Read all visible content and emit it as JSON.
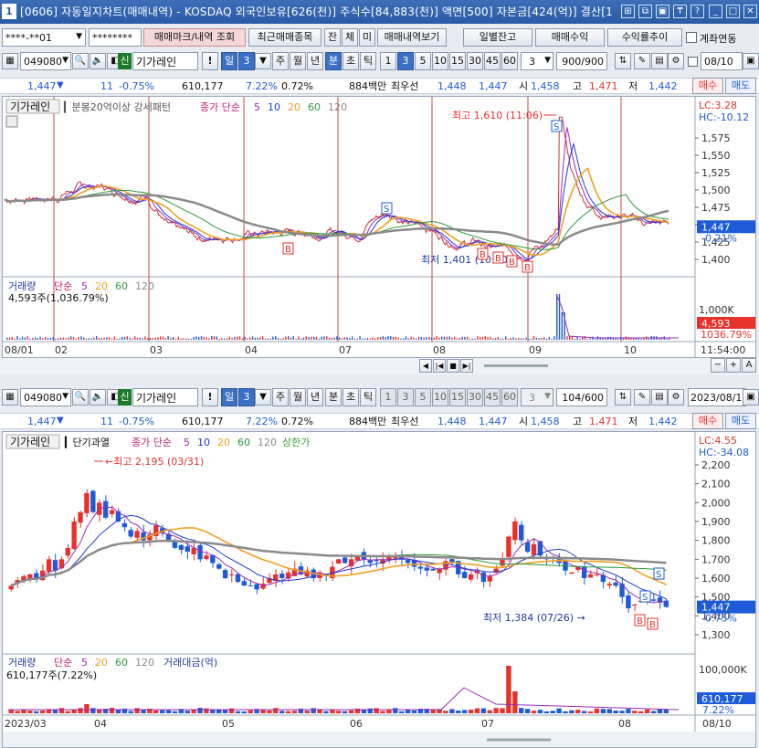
{
  "title": "[0606] 자동일지차트(매매내역) - KOSDAQ 외국인보유[626(천)] 주식수[84,883(천)] 액면[500] 자본금[424(억)] 결산[1",
  "title_buttons": [
    "⊞",
    "⧉",
    "▣",
    "₸",
    "?",
    "_",
    "□",
    "✕"
  ],
  "account": {
    "id": "****-**01",
    "password": "********",
    "btn_mark": "매매마크/내역 조회",
    "btn_recent": "최근매매종목",
    "tab_jan": "잔",
    "tab_che": "체",
    "tab_mi": "미",
    "btn_history": "매매내역보기",
    "btn_daily": "일별잔고",
    "btn_profit": "매매수익",
    "btn_return": "수익률추이",
    "chk_account": "계좌연동"
  },
  "top_toolbar": {
    "code": "049080",
    "badge": "신",
    "name": "기가레인",
    "excl": "!",
    "period_btn": "일",
    "period_num": "3",
    "periods": [
      "주",
      "월",
      "년",
      "분",
      "초",
      "틱"
    ],
    "minute_nums": [
      "1",
      "3",
      "5",
      "10",
      "15",
      "30",
      "45",
      "60"
    ],
    "count_select": "3",
    "range": "900/900",
    "date": "08/10"
  },
  "bottom_toolbar": {
    "code": "049080",
    "badge": "신",
    "name": "기가레인",
    "excl": "!",
    "period_btn": "일",
    "period_num": "3",
    "periods": [
      "주",
      "월",
      "년",
      "분",
      "초",
      "틱"
    ],
    "minute_nums": [
      "1",
      "3",
      "5",
      "10",
      "15",
      "30",
      "45",
      "60"
    ],
    "count_select": "3",
    "range": "104/600",
    "date": "2023/08/10"
  },
  "price_row": {
    "price": "1,447",
    "change": "11",
    "pct": "-0.75%",
    "volume": "610,177",
    "vol_pct": "7.22%",
    "turnover": "0.72%",
    "amount": "884백만",
    "best_label": "최우선",
    "bid1": "1,448",
    "ask1": "1,447",
    "open_label": "시",
    "open": "1,458",
    "high_label": "고",
    "high": "1,471",
    "low_label": "저",
    "low": "1,442",
    "buy": "매수",
    "sell": "매도"
  },
  "chart1": {
    "tag": "기가레인",
    "indicator": "분봉20억이상 강세패턴",
    "ma_label": "종가 단순",
    "ma_periods": [
      "5",
      "10",
      "20",
      "60",
      "120"
    ],
    "lc": "LC:3.28",
    "hc": "HC:-10.12",
    "high_note": "최고 1,610 (11:06)",
    "low_note": "최저 1,401 (10:00)",
    "yticks": [
      "1,575",
      "1,550",
      "1,525",
      "1,500",
      "1,475",
      "1,450",
      "1,425",
      "1,400"
    ],
    "cur_price": "1,447",
    "cur_pct": "-0.21%",
    "vol_title": "거래량",
    "vol_ma": "단순",
    "vol_periods": [
      "5",
      "20",
      "60",
      "120"
    ],
    "vol_info": "4,593주(1,036.79%)",
    "vol_tick": "1,000K",
    "vol_cur": "4,593",
    "vol_cur_pct": "1036.79%",
    "xticks": [
      "08/01",
      "02",
      "03",
      "04",
      "07",
      "08",
      "09",
      "10"
    ],
    "time": "11:54:00"
  },
  "chart2": {
    "tag": "기가레인",
    "indicator": "단기과열",
    "ma_label": "종가 단순",
    "ma_periods": [
      "5",
      "10",
      "20",
      "60",
      "120"
    ],
    "limit_label": "상한가",
    "lc": "LC:4.55",
    "hc": "HC:-34.08",
    "high_note": "최고 2,195 (03/31)",
    "low_note": "최저 1,384 (07/26)",
    "yticks": [
      "2,200",
      "2,100",
      "2,000",
      "1,900",
      "1,800",
      "1,700",
      "1,600",
      "1,500",
      "1,400",
      "1,300"
    ],
    "cur_price": "1,447",
    "cur_pct": "-0.75%",
    "vol_title": "거래량",
    "vol_ma": "단순",
    "vol_periods": [
      "5",
      "20",
      "60",
      "120"
    ],
    "amount_label": "거래대금(억)",
    "vol_info": "610,177주(7.22%)",
    "vol_tick": "100,000K",
    "vol_cur": "610,177",
    "vol_cur_pct": "7.22%",
    "xticks": [
      "2023/03",
      "04",
      "05",
      "06",
      "07",
      "08"
    ],
    "date": "08/10"
  },
  "scroll_buttons": [
    "◀",
    "|◀",
    "■",
    "▶|",
    "▶"
  ],
  "colors": {
    "up": "#e8312b",
    "down": "#1e5bd8",
    "ma5": "#9a2db5",
    "ma10": "#1e3bd8",
    "ma20": "#f0a020",
    "ma60": "#2a9a3a",
    "ma120": "#8a8a8a",
    "title_bg": "#2f62ad"
  }
}
